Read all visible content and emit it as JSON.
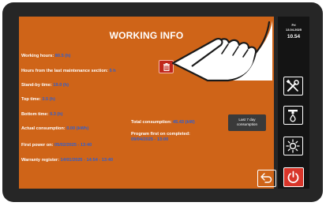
{
  "title": "WORKING INFO",
  "info": {
    "working_hours": {
      "label": "Working hours:",
      "value": "80.5 (h)"
    },
    "hours_since_maintenance": {
      "label": "Hours from the last maintenance section:",
      "value": "5 h"
    },
    "standby_time": {
      "label": "Stand-by time:",
      "value": "19.0 (h)"
    },
    "top_time": {
      "label": "Top time:",
      "value": "3.5 (h)"
    },
    "bottom_time": {
      "label": "Bottom time:",
      "value": "0.3 (h)"
    },
    "actual_consumption": {
      "label": "Actual consumption:",
      "value": "0.00 (kWh)"
    },
    "first_power_on": {
      "label": "First power on:",
      "value": "05/02/2025 - 13:40"
    },
    "warranty_register": {
      "label": "Warranty register:",
      "value": "14/01/2025 - 14:54 - 13:40"
    },
    "total_consumption": {
      "label": "Total consumption:",
      "value": "45.43 (kW)"
    },
    "program_first_on": {
      "label": "Program first on completed:",
      "value": "09/04/2025 - 13:00"
    }
  },
  "buttons": {
    "last7_line1": "Last 7 day",
    "last7_line2": "consumption"
  },
  "clock": {
    "day": "Fri",
    "date": "13.04.2025",
    "time": "10.54"
  },
  "colors": {
    "screen": "#cf6418",
    "value_text": "#2f5fd0",
    "sidebar": "#141414",
    "reset_button": "#c0271b",
    "power_button": "#d8352a"
  },
  "icons": [
    "trash-icon",
    "tools-icon",
    "water-drain-icon",
    "sun-icon",
    "power-icon",
    "back-arrow-icon",
    "pointing-hand-icon"
  ]
}
